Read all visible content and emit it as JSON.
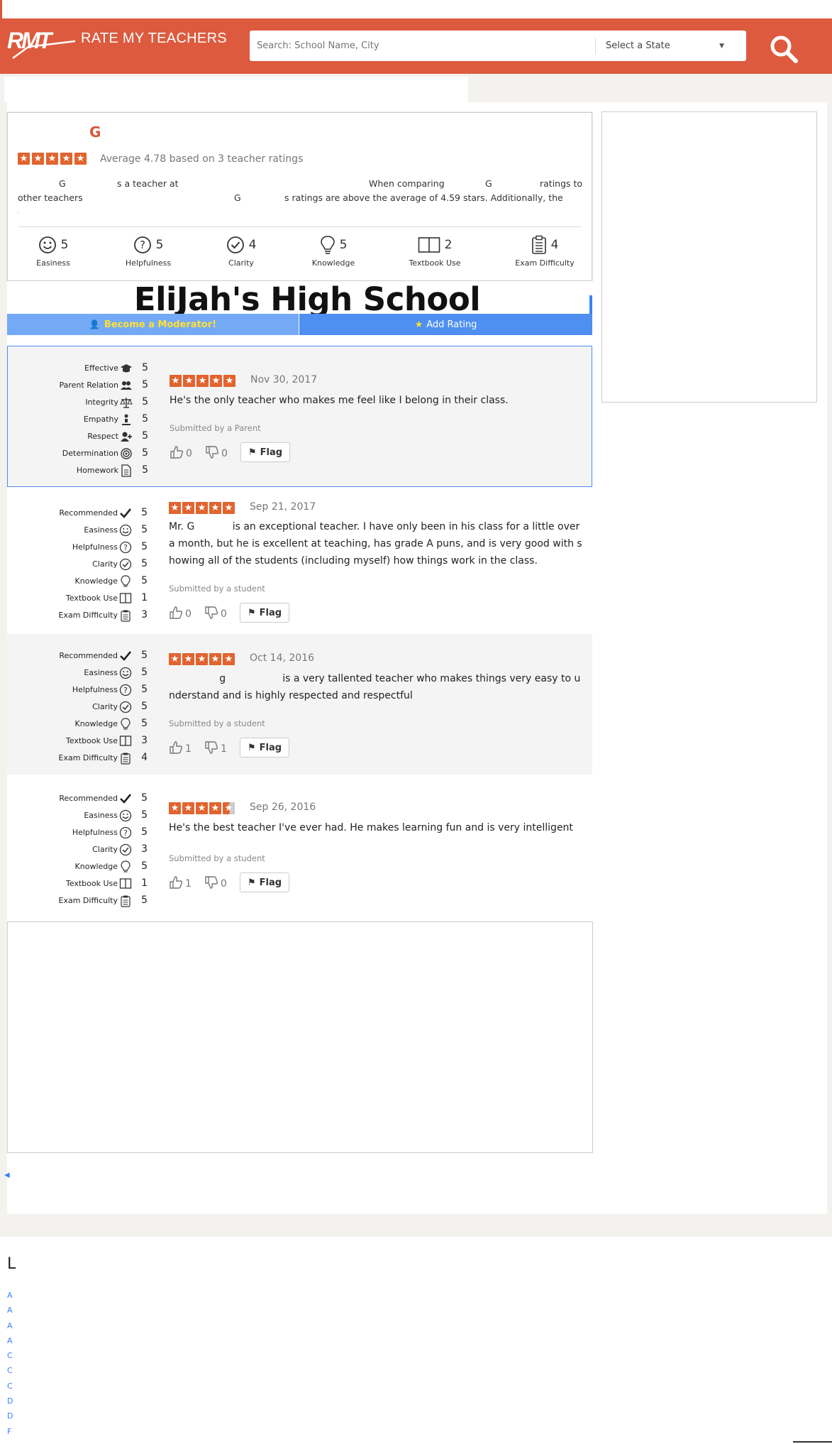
{
  "header": {
    "logo_text": "RMT",
    "brand": "RATE MY TEACHERS",
    "search_placeholder": "Search: School Name, City",
    "state_select": "Select a State",
    "colors": {
      "brand": "#dd5a3e",
      "accent_blue": "#4e8ff1"
    }
  },
  "teacher": {
    "name_initial": "G",
    "average_text": "Average 4.78 based on 3 teacher ratings",
    "rating_stars": 5,
    "description": {
      "part1": "G",
      "part2": "s a teacher at",
      "part3": "When comparing",
      "part4": "G",
      "part5": "ratings to",
      "part6": "other teachers",
      "part7": "G",
      "part8": "s ratings are above the average of 4.59 stars. Additionally, the",
      "part9": "."
    },
    "metrics": [
      {
        "label": "Easiness",
        "value": "5",
        "icon": "smile-icon"
      },
      {
        "label": "Helpfulness",
        "value": "5",
        "icon": "question-icon"
      },
      {
        "label": "Clarity",
        "value": "4",
        "icon": "check-circle-icon"
      },
      {
        "label": "Knowledge",
        "value": "5",
        "icon": "lightbulb-icon"
      },
      {
        "label": "Textbook Use",
        "value": "2",
        "icon": "book-icon"
      },
      {
        "label": "Exam Difficulty",
        "value": "4",
        "icon": "clipboard-icon"
      }
    ]
  },
  "school_name": "EliJah's High School",
  "actions": {
    "moderator": "Become a Moderator!",
    "add_rating": "Add Rating"
  },
  "reviews": [
    {
      "categories": [
        {
          "label": "Effective",
          "value": "5",
          "icon": "graduation-cap-icon"
        },
        {
          "label": "Parent Relation",
          "value": "5",
          "icon": "users-icon"
        },
        {
          "label": "Integrity",
          "value": "5",
          "icon": "scale-icon"
        },
        {
          "label": "Empathy",
          "value": "5",
          "icon": "hand-icon"
        },
        {
          "label": "Respect",
          "value": "5",
          "icon": "user-plus-icon"
        },
        {
          "label": "Determination",
          "value": "5",
          "icon": "target-icon"
        },
        {
          "label": "Homework",
          "value": "5",
          "icon": "document-icon"
        }
      ],
      "stars": 5,
      "date": "Nov 30, 2017",
      "text": "He's the only teacher who makes me feel like I belong in their class.",
      "submitted": "Submitted by a Parent",
      "up": "0",
      "down": "0",
      "flag": "Flag"
    },
    {
      "categories": [
        {
          "label": "Recommended",
          "value": "5",
          "icon": "checkmark-icon"
        },
        {
          "label": "Easiness",
          "value": "5",
          "icon": "smile-icon"
        },
        {
          "label": "Helpfulness",
          "value": "5",
          "icon": "question-icon"
        },
        {
          "label": "Clarity",
          "value": "5",
          "icon": "check-circle-icon"
        },
        {
          "label": "Knowledge",
          "value": "5",
          "icon": "lightbulb-icon"
        },
        {
          "label": "Textbook Use",
          "value": "1",
          "icon": "book-icon"
        },
        {
          "label": "Exam Difficulty",
          "value": "3",
          "icon": "clipboard-icon"
        }
      ],
      "stars": 5,
      "date": "Sep 21, 2017",
      "text": "Mr. G            is an exceptional teacher. I have only been in his class for a little over a month, but he is excellent at teaching, has grade A puns, and is very good with showing all of the students (including myself) how things work in the class.",
      "submitted": "Submitted by a student",
      "up": "0",
      "down": "0",
      "flag": "Flag"
    },
    {
      "categories": [
        {
          "label": "Recommended",
          "value": "5",
          "icon": "checkmark-icon"
        },
        {
          "label": "Easiness",
          "value": "5",
          "icon": "smile-icon"
        },
        {
          "label": "Helpfulness",
          "value": "5",
          "icon": "question-icon"
        },
        {
          "label": "Clarity",
          "value": "5",
          "icon": "check-circle-icon"
        },
        {
          "label": "Knowledge",
          "value": "5",
          "icon": "lightbulb-icon"
        },
        {
          "label": "Textbook Use",
          "value": "3",
          "icon": "book-icon"
        },
        {
          "label": "Exam Difficulty",
          "value": "4",
          "icon": "clipboard-icon"
        }
      ],
      "stars": 5,
      "date": "Oct 14, 2016",
      "text": "                g                  is a very tallented teacher who makes things very easy to understand and is highly respected and respectful",
      "submitted": "Submitted by a student",
      "up": "1",
      "down": "1",
      "flag": "Flag"
    },
    {
      "categories": [
        {
          "label": "Recommended",
          "value": "5",
          "icon": "checkmark-icon"
        },
        {
          "label": "Easiness",
          "value": "5",
          "icon": "smile-icon"
        },
        {
          "label": "Helpfulness",
          "value": "5",
          "icon": "question-icon"
        },
        {
          "label": "Clarity",
          "value": "3",
          "icon": "check-circle-icon"
        },
        {
          "label": "Knowledge",
          "value": "5",
          "icon": "lightbulb-icon"
        },
        {
          "label": "Textbook Use",
          "value": "1",
          "icon": "book-icon"
        },
        {
          "label": "Exam Difficulty",
          "value": "5",
          "icon": "clipboard-icon"
        }
      ],
      "stars": 4.5,
      "date": "Sep 26, 2016",
      "text": "He's the best teacher I've ever had. He makes learning fun and is very intelligent",
      "submitted": "Submitted by a student",
      "up": "1",
      "down": "0",
      "flag": "Flag"
    }
  ],
  "footer": {
    "heading_letter": "L",
    "links": [
      "A",
      "A",
      "A",
      "A",
      "C",
      "C",
      "C",
      "D",
      "D",
      "F"
    ]
  }
}
